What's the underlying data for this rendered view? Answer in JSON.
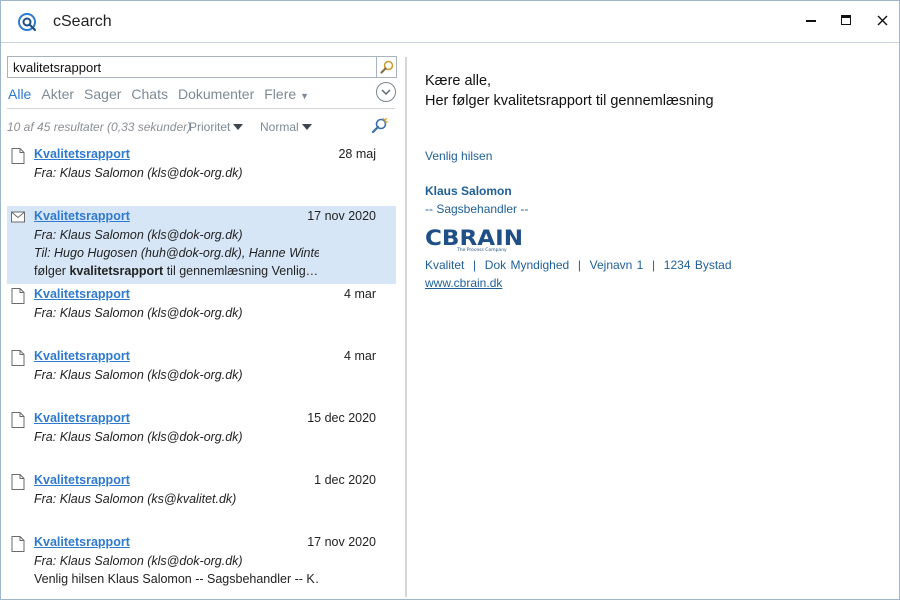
{
  "window": {
    "title": "cSearch",
    "app_icon": "csearch-logo-icon",
    "controls": [
      "minimize-icon",
      "maximize-icon",
      "close-icon"
    ]
  },
  "search": {
    "value": "kvalitetsrapport",
    "placeholder": "",
    "button_icon": "search-icon"
  },
  "filters": {
    "tabs": [
      {
        "label": "Alle",
        "active": true
      },
      {
        "label": "Akter",
        "active": false
      },
      {
        "label": "Sager",
        "active": false
      },
      {
        "label": "Chats",
        "active": false
      },
      {
        "label": "Dokumenter",
        "active": false
      }
    ],
    "more_label": "Flere",
    "expand_icon": "chevron-down-circle-icon"
  },
  "results_meta": {
    "summary": "10 af 45 resultater (0,33 sekunder)",
    "sort_priority": "Prioritet",
    "sort_normal": "Normal",
    "refine_icon": "refine-search-icon"
  },
  "results": [
    {
      "icon": "document-icon",
      "title": "Kvalitetsrapport",
      "date": "28 maj",
      "from": "Fra: Klaus Salomon (kls@dok-org.dk)",
      "selected": false
    },
    {
      "icon": "envelope-icon",
      "title": "Kvalitetsrapport",
      "date": "17 nov 2020",
      "from": "Fra: Klaus Salomon (kls@dok-org.dk)",
      "to": "Til: Hugo Hugosen (huh@dok-org.dk), Hanne Winte…",
      "snippet_pre": "følger ",
      "snippet_bold": "kvalitetsrapport",
      "snippet_post": " til gennemlæsning Venlig…",
      "selected": true
    },
    {
      "icon": "document-icon",
      "title": "Kvalitetsrapport",
      "date": "4 mar",
      "from": "Fra: Klaus Salomon (kls@dok-org.dk)",
      "selected": false
    },
    {
      "icon": "document-icon",
      "title": "Kvalitetsrapport",
      "date": "4 mar",
      "from": "Fra: Klaus Salomon (kls@dok-org.dk)",
      "selected": false
    },
    {
      "icon": "document-icon",
      "title": "Kvalitetsrapport",
      "date": "15 dec 2020",
      "from": "Fra: Klaus Salomon (kls@dok-org.dk)",
      "selected": false
    },
    {
      "icon": "document-icon",
      "title": "Kvalitetsrapport",
      "date": "1 dec 2020",
      "from": "Fra: Klaus Salomon (ks@kvalitet.dk)",
      "selected": false
    },
    {
      "icon": "document-icon",
      "title": "Kvalitetsrapport",
      "date": "17 nov 2020",
      "from": "Fra: Klaus Salomon (kls@dok-org.dk)",
      "snippet": "Venlig hilsen Klaus Salomon -- Sagsbehandler -- K…",
      "selected": false
    }
  ],
  "preview": {
    "greeting": "Kære alle,",
    "body": "Her følger kvalitetsrapport til gennemlæsning",
    "closing": "Venlig hilsen",
    "sender_name": "Klaus Salomon",
    "sender_role": "-- Sagsbehandler --",
    "logo_text": "CBRAIN",
    "logo_tagline": "The Process Company",
    "address": "Kvalitet  |  Dok Myndighed  |  Vejnavn 1  |  1234 Bystad",
    "website": "www.cbrain.dk"
  },
  "colors": {
    "accent": "#2d7bd0",
    "link": "#2f7ad1",
    "signature": "#1f5f99",
    "selected_row": "#d7e6f6",
    "logo": "#1e4f86"
  }
}
